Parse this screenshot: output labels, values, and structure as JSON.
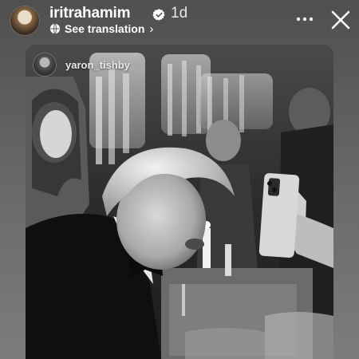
{
  "story": {
    "username": "iritrahamim",
    "verified": true,
    "time": "1d",
    "translation_label": "See translation",
    "translation_chevron": "›",
    "icons": {
      "avatar": "profile-avatar",
      "verified": "verified-badge-icon",
      "globe": "globe-icon",
      "more": "more-horizontal-icon",
      "close": "close-icon"
    }
  },
  "post": {
    "username": "yaron_tishby",
    "photo_description_tone": "black-and-white"
  },
  "colors": {
    "background_top": "#4f4f4f",
    "background_bottom": "#7c7c7c",
    "text": "#ffffff"
  }
}
